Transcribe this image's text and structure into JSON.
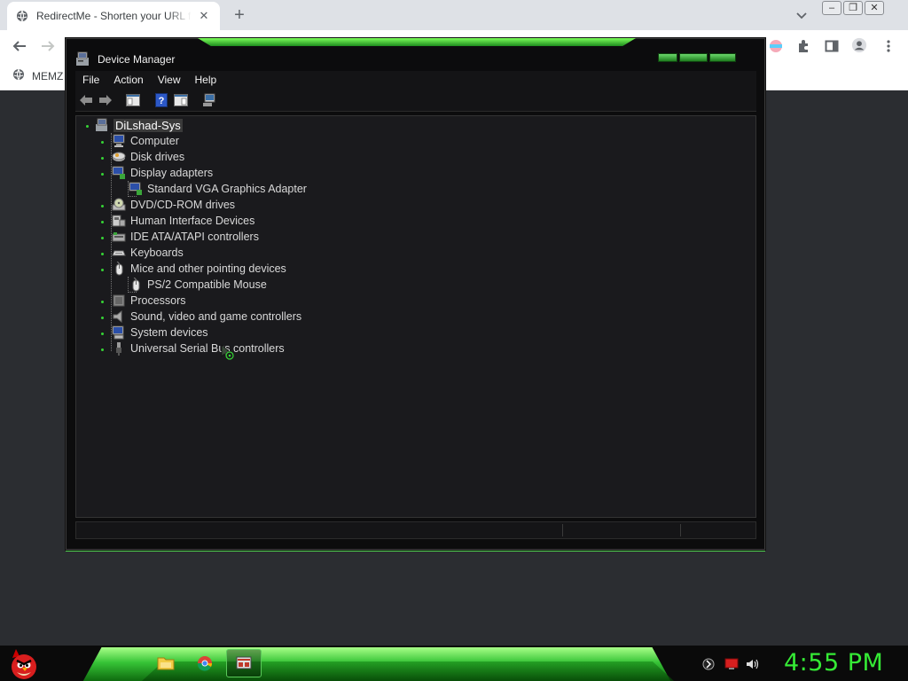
{
  "browser": {
    "tab_title": "RedirectMe - Shorten your URL f",
    "bookmark_label": "MEMZ"
  },
  "window": {
    "title": "Device Manager",
    "menu": [
      "File",
      "Action",
      "View",
      "Help"
    ]
  },
  "tree": {
    "root": "DiLshad-Sys",
    "items": [
      {
        "label": "Computer",
        "icon": "computer-icon"
      },
      {
        "label": "Disk drives",
        "icon": "disk-drive-icon"
      },
      {
        "label": "Display adapters",
        "icon": "display-adapter-icon",
        "children": [
          "Standard VGA Graphics Adapter"
        ]
      },
      {
        "label": "DVD/CD-ROM drives",
        "icon": "dvd-drive-icon"
      },
      {
        "label": "Human Interface Devices",
        "icon": "hid-icon"
      },
      {
        "label": "IDE ATA/ATAPI controllers",
        "icon": "ide-controller-icon"
      },
      {
        "label": "Keyboards",
        "icon": "keyboard-icon"
      },
      {
        "label": "Mice and other pointing devices",
        "icon": "mouse-icon",
        "children": [
          "PS/2 Compatible Mouse"
        ]
      },
      {
        "label": "Processors",
        "icon": "processor-icon"
      },
      {
        "label": "Sound, video and game controllers",
        "icon": "speaker-icon"
      },
      {
        "label": "System devices",
        "icon": "system-device-icon"
      },
      {
        "label": "Universal Serial Bus controllers",
        "icon": "usb-icon"
      }
    ]
  },
  "taskbar": {
    "clock": "4:55 PM",
    "buttons": [
      "file-explorer-icon",
      "chrome-icon",
      "device-manager-icon"
    ]
  },
  "colors": {
    "accent_green": "#35ea35",
    "window_bg": "#0c0c0d",
    "tree_bg": "#1a1a1d"
  }
}
